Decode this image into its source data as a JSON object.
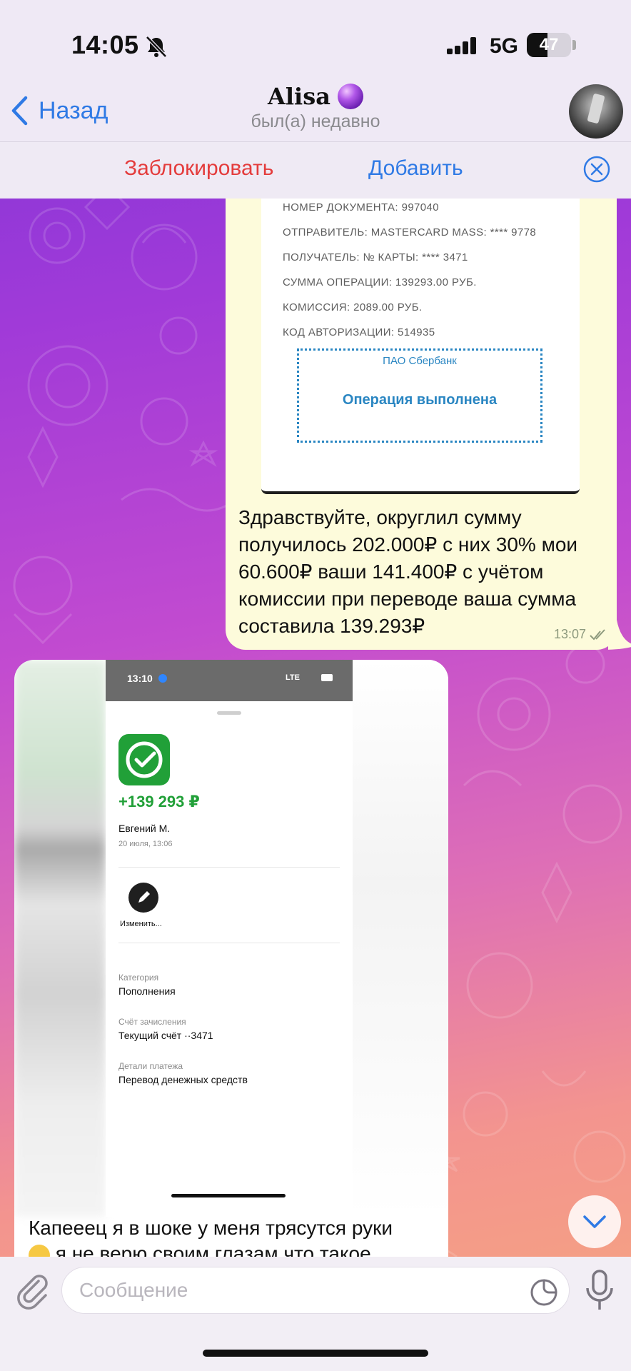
{
  "status_bar": {
    "time": "14:05",
    "network": "5G",
    "battery": "47",
    "battery_level": 0.47
  },
  "header": {
    "back_label": "Назад",
    "chat_name": "Alisa",
    "chat_status": "был(а) недавно",
    "block_label": "Заблокировать",
    "add_label": "Добавить"
  },
  "messages": {
    "outgoing": {
      "receipt": {
        "lines": [
          "НОМЕР ДОКУМЕНТА: 997040",
          "ОТПРАВИТЕЛЬ: MASTERCARD MASS: **** 9778",
          "ПОЛУЧАТЕЛЬ: № КАРТЫ: **** 3471",
          "СУММА ОПЕРАЦИИ: 139293.00 РУБ.",
          "КОМИССИЯ: 2089.00 РУБ.",
          "КОД АВТОРИЗАЦИИ: 514935"
        ],
        "bank": "ПАО Сбербанк",
        "status": "Операция выполнена"
      },
      "text": "Здравствуйте, округлил сумму получилось 202.000₽ с них 30% мои 60.600₽ ваши 141.400₽ с учётом комиссии при переводе ваша сумма составила 139.293₽",
      "time": "13:07"
    },
    "incoming": {
      "screenshot": {
        "time": "13:10",
        "network": "LTE",
        "amount": "+139 293 ₽",
        "payer": "Евгений М.",
        "date": "20 июля, 13:06",
        "edit_label": "Изменить...",
        "details": [
          {
            "label": "Категория",
            "value": "Пополнения"
          },
          {
            "label": "Счёт зачисления",
            "value": "Текущий счёт ··3471"
          },
          {
            "label": "Детали платежа",
            "value": "Перевод денежных средств"
          }
        ]
      },
      "text_line1": "Капееец я в шоке у меня трясутся руки",
      "text_line2": "я не верю своим глазам что такое"
    }
  },
  "composer": {
    "placeholder": "Сообщение"
  },
  "icons": [
    "bell-slash-icon",
    "signal-icon",
    "chevron-left-icon",
    "close-icon",
    "double-check-icon",
    "checkmark-icon",
    "pencil-icon",
    "chevron-down-icon",
    "paperclip-icon",
    "sticker-icon",
    "microphone-icon"
  ],
  "colors": {
    "accent": "#2f7ae5",
    "danger": "#e43c3c",
    "sber_green": "#21a038",
    "outgoing_bubble": "#fdfbdb"
  }
}
